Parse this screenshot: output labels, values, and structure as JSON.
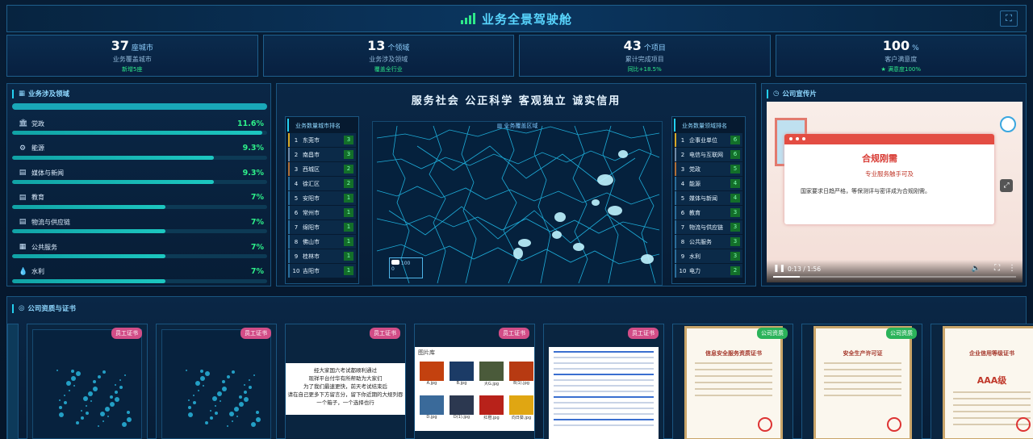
{
  "header": {
    "title": "业务全景驾驶舱",
    "fullscreen_icon": "fullscreen-icon"
  },
  "stats": [
    {
      "value": "37",
      "unit": "座城市",
      "label": "业务覆盖城市",
      "sub": "新增5座"
    },
    {
      "value": "13",
      "unit": "个领域",
      "label": "业务涉及领域",
      "sub": "覆盖全行业"
    },
    {
      "value": "43",
      "unit": "个项目",
      "label": "累计完成项目",
      "sub": "同比+18.5%"
    },
    {
      "value": "100",
      "unit": "%",
      "label": "客户满意度",
      "sub": "★ 满意度100%"
    }
  ],
  "domains": {
    "title": "业务涉及领域",
    "items": [
      {
        "name": "党政",
        "pct": "11.6%",
        "fill": 0.98
      },
      {
        "name": "能源",
        "pct": "9.3%",
        "fill": 0.79
      },
      {
        "name": "媒体与新闻",
        "pct": "9.3%",
        "fill": 0.79
      },
      {
        "name": "教育",
        "pct": "7%",
        "fill": 0.6
      },
      {
        "name": "物流与供应链",
        "pct": "7%",
        "fill": 0.6
      },
      {
        "name": "公共服务",
        "pct": "7%",
        "fill": 0.6
      },
      {
        "name": "水利",
        "pct": "7%",
        "fill": 0.6
      }
    ]
  },
  "slogan": "服务社会  公正科学  客观独立  诚实信用",
  "city_rank": {
    "title": "业务数量城市排名",
    "items": [
      {
        "n": "1",
        "name": "东莞市",
        "c": "3"
      },
      {
        "n": "2",
        "name": "南昌市",
        "c": "3"
      },
      {
        "n": "3",
        "name": "西城区",
        "c": "2"
      },
      {
        "n": "4",
        "name": "徐汇区",
        "c": "2"
      },
      {
        "n": "5",
        "name": "安阳市",
        "c": "1"
      },
      {
        "n": "6",
        "name": "常州市",
        "c": "1"
      },
      {
        "n": "7",
        "name": "绵阳市",
        "c": "1"
      },
      {
        "n": "8",
        "name": "佛山市",
        "c": "1"
      },
      {
        "n": "9",
        "name": "桂林市",
        "c": "1"
      },
      {
        "n": "10",
        "name": "吉阳市",
        "c": "1"
      }
    ]
  },
  "map": {
    "title": "业务覆盖区域",
    "legend_max": "100",
    "legend_min": "0"
  },
  "field_rank": {
    "title": "业务数量领域排名",
    "items": [
      {
        "n": "1",
        "name": "企事业单位",
        "c": "6"
      },
      {
        "n": "2",
        "name": "电信与互联网",
        "c": "6"
      },
      {
        "n": "3",
        "name": "党政",
        "c": "5"
      },
      {
        "n": "4",
        "name": "能源",
        "c": "4"
      },
      {
        "n": "5",
        "name": "媒体与新闻",
        "c": "4"
      },
      {
        "n": "6",
        "name": "教育",
        "c": "3"
      },
      {
        "n": "7",
        "name": "物流与供应链",
        "c": "3"
      },
      {
        "n": "8",
        "name": "公共服务",
        "c": "3"
      },
      {
        "n": "9",
        "name": "水利",
        "c": "3"
      },
      {
        "n": "10",
        "name": "电力",
        "c": "2"
      }
    ]
  },
  "video": {
    "title": "公司宣传片",
    "headline": "合规刚需",
    "subhead": "专业服务触手可及",
    "body": "国家要求日趋严格，等保测评与密评成为合规刚需。",
    "time": "0:13 / 1:56",
    "progress": 0.11
  },
  "certs": {
    "title": "公司资质与证书",
    "cards": [
      {
        "tag": "员工证书",
        "tag_color": "pink",
        "kind": "dash"
      },
      {
        "tag": "员工证书",
        "tag_color": "pink",
        "kind": "dash"
      },
      {
        "tag": "员工证书",
        "tag_color": "pink",
        "kind": "text",
        "lines": [
          "经大家国六考试都顺利通过",
          "现祥平台付华有所帮助为大家们",
          "为了我们最速更快，前天考试结束后",
          "请在自己更多下方留言分，留下你近期的大规列吞",
          "一个箱子，一个选择也行"
        ]
      },
      {
        "tag": "员工证书",
        "tag_color": "pink",
        "kind": "photos",
        "header": "图片库",
        "photos": [
          "A.jpg",
          "B.jpg",
          "大G.jpg",
          "B(1).jpg",
          "D.jpg",
          "D(1).jpg",
          "红橙.jpg",
          "向日葵.jpg"
        ]
      },
      {
        "tag": "员工证书",
        "tag_color": "pink",
        "kind": "doc"
      },
      {
        "tag": "公司资质",
        "tag_color": "green",
        "kind": "cert",
        "header": "信息安全服务资质证书"
      },
      {
        "tag": "公司资质",
        "tag_color": "green",
        "kind": "cert",
        "header": "安全生产许可证"
      },
      {
        "tag": "",
        "tag_color": "green",
        "kind": "cert",
        "header": "企业信用等级证书",
        "big": "AAA级"
      }
    ]
  }
}
